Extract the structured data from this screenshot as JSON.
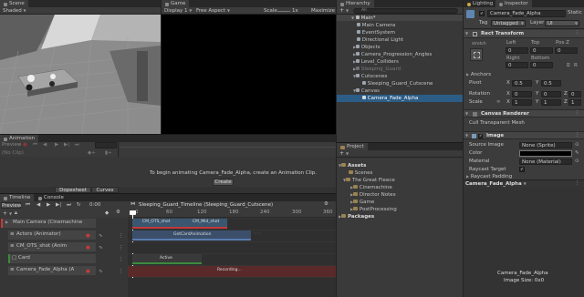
{
  "scene": {
    "tab": "Scene",
    "shading": "Shaded"
  },
  "game": {
    "tab": "Game",
    "display": "Display 1",
    "aspect": "Free Aspect",
    "scale_label": "Scale",
    "scale_value": "1x",
    "maximize": "Maximize"
  },
  "hierarchy": {
    "tab": "Hierarchy",
    "search_placeholder": "All",
    "items": [
      {
        "label": "Main*"
      },
      {
        "label": "Main Camera"
      },
      {
        "label": "EventSystem"
      },
      {
        "label": "Directional Light"
      },
      {
        "label": "Objects"
      },
      {
        "label": "Camera_Progression_Angles"
      },
      {
        "label": "Level_Colliders"
      },
      {
        "label": "Sleeping_Guard"
      },
      {
        "label": "Cutscenes"
      },
      {
        "label": "Sleeping_Guard_Cutscene"
      },
      {
        "label": "Canvas"
      },
      {
        "label": "Camera_Fade_Alpha"
      }
    ]
  },
  "inspector": {
    "tabs": [
      "Lighting",
      "Inspector"
    ],
    "object_name": "Camera_Fade_Alpha",
    "static_label": "Static",
    "tag_label": "Tag",
    "tag_value": "Untagged",
    "layer_label": "Layer",
    "layer_value": "UI",
    "rect_transform": {
      "title": "Rect Transform",
      "stretch": "stretch",
      "headers": [
        "Left",
        "Top",
        "Pos Z"
      ],
      "values": [
        "0",
        "0",
        "0"
      ],
      "headers2": [
        "Right",
        "Bottom"
      ],
      "values2": [
        "0",
        "0"
      ],
      "anchors": "Anchors",
      "pivot_label": "Pivot",
      "pivot": {
        "x_label": "X",
        "x": "0.5",
        "y_label": "Y",
        "y": "0.5"
      },
      "rotation_label": "Rotation",
      "rotation": {
        "x_label": "X",
        "x": "0",
        "y_label": "Y",
        "y": "0",
        "z_label": "Z",
        "z": "0"
      },
      "scale_label": "Scale",
      "scale": {
        "x_label": "X",
        "x": "1",
        "y_label": "Y",
        "y": "1",
        "z_label": "Z",
        "z": "1"
      }
    },
    "canvas_renderer": {
      "title": "Canvas Renderer",
      "cull_label": "Cull Transparent Mesh"
    },
    "image": {
      "title": "Image",
      "source_label": "Source Image",
      "source_value": "None (Sprite)",
      "color_label": "Color",
      "color_value": "#000000",
      "material_label": "Material",
      "material_value": "None (Material)",
      "raycast_label": "Raycast Target",
      "padding_label": "Raycast Padding"
    },
    "preview_header": "Camera_Fade_Alpha",
    "preview_name": "Camera_Fade_Alpha",
    "preview_size": "Image Size: 0x0"
  },
  "animation": {
    "tab": "Animation",
    "preview": "Preview",
    "clip": "(No Clip)",
    "message": "To begin animating Camera_Fade_Alpha, create an Animation Clip.",
    "create": "Create",
    "dopesheet": "Dopesheet",
    "curves": "Curves"
  },
  "project": {
    "tab": "Project",
    "tree": [
      {
        "label": "Assets"
      },
      {
        "label": "Scenes"
      },
      {
        "label": "The Great Fleece"
      },
      {
        "label": "Cinemachine"
      },
      {
        "label": "Director Notes"
      },
      {
        "label": "Game"
      },
      {
        "label": "PostProcessing"
      },
      {
        "label": "Packages"
      }
    ]
  },
  "timeline": {
    "tabs": [
      "Timeline",
      "Console"
    ],
    "preview": "Preview",
    "time": "0:00",
    "title": "Sleeping_Guard_Timeline (Sleeping_Guard_Cutscene)",
    "ruler": [
      "0",
      "60",
      "120",
      "180",
      "240",
      "300",
      "360"
    ],
    "tracks": [
      {
        "label": "Main Camera (Cinemachine"
      },
      {
        "label": "Actors (Animator)"
      },
      {
        "label": "CM_OTS_shot (Anim"
      },
      {
        "label": "Card"
      },
      {
        "label": "Camera_Fade_Alpha (A"
      }
    ],
    "clips": {
      "cm_ots": "CM_OTS_shot",
      "cm_mid": "CM_Mid_shot",
      "animation_clip": "GetCardAnimation",
      "active": "Active",
      "recording": "Recording..."
    }
  },
  "colors": {
    "accent": "#2c5d87",
    "recording": "#5a2a2a",
    "blue_clip": "#3b5670",
    "green": "#3d8a3d",
    "red": "#c23b3b"
  }
}
